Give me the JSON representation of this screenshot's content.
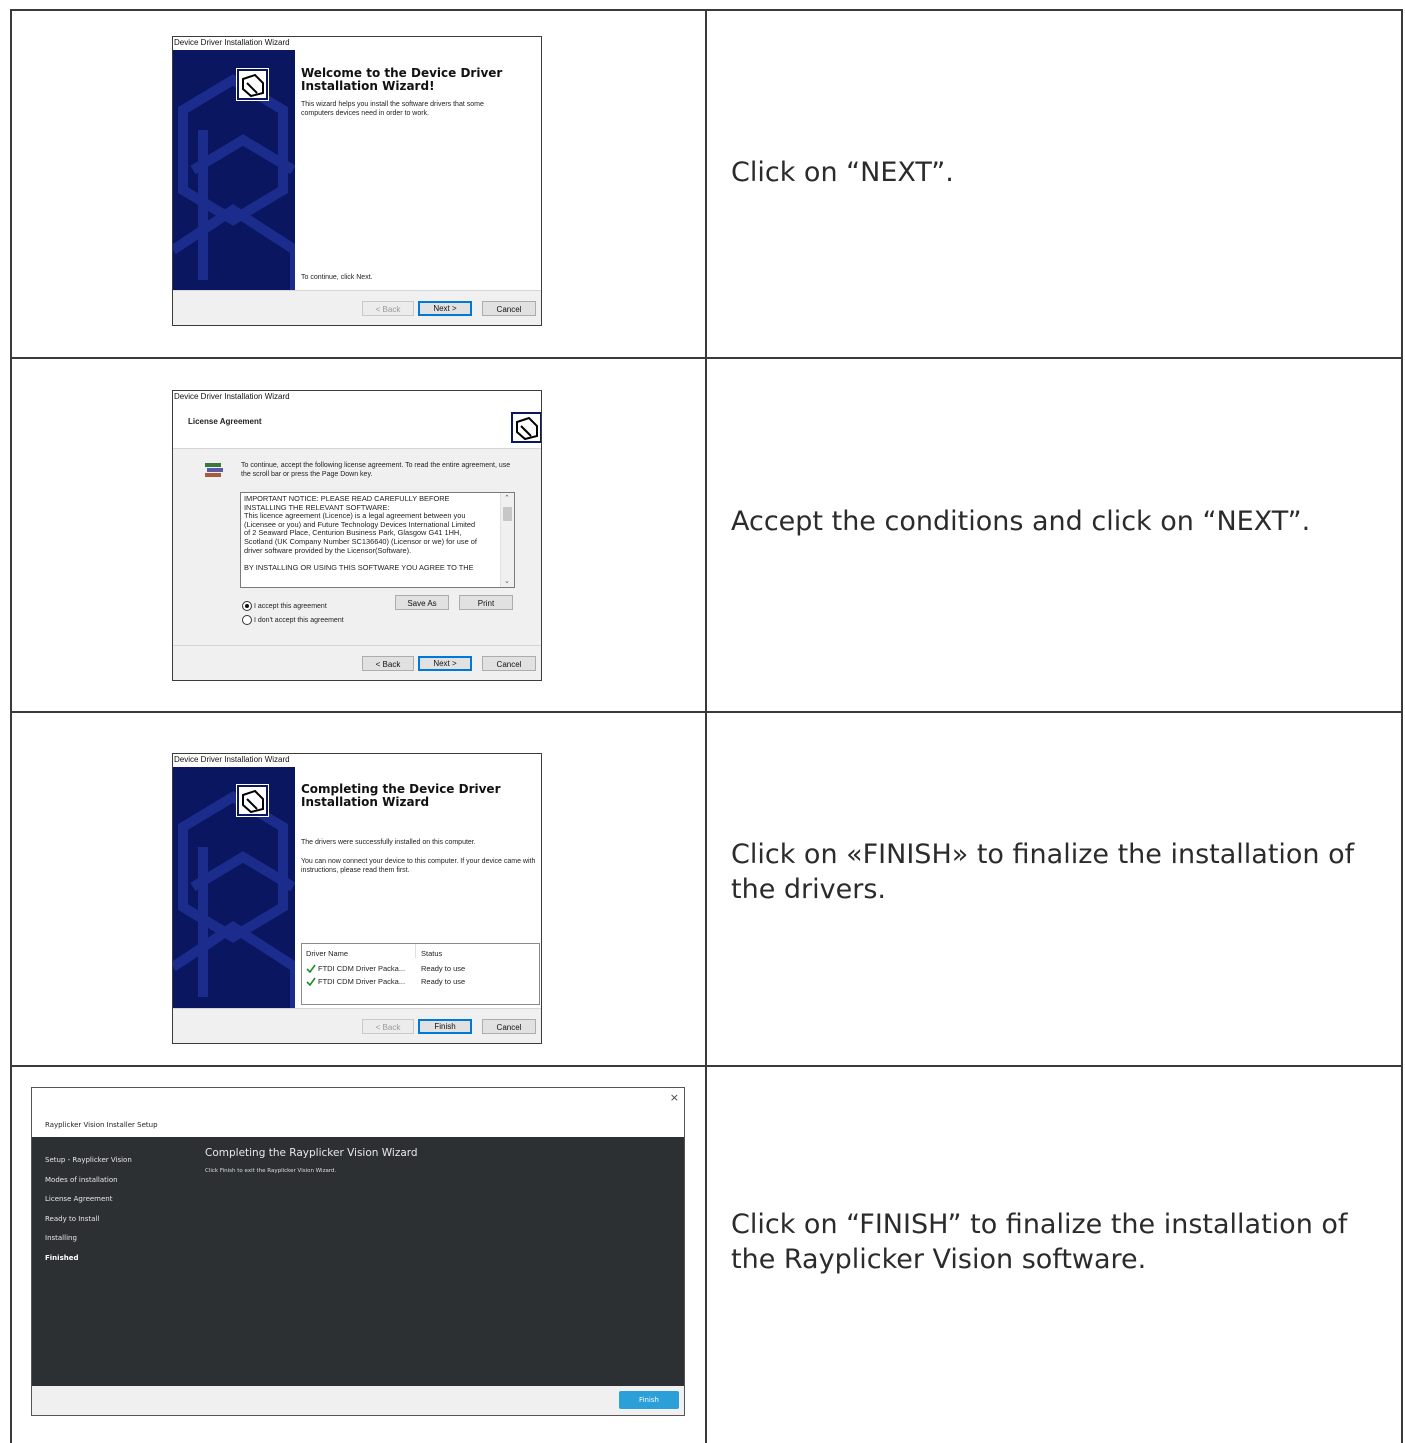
{
  "rows": [
    {
      "caption": "Click on “NEXT”.",
      "dialog": {
        "title": "Device Driver Installation Wizard",
        "heading": "Welcome to the Device Driver Installation Wizard!",
        "body": "This wizard helps you install the software drivers that some computers devices need in order to work.",
        "continue_text": "To continue, click Next.",
        "buttons": {
          "back": "< Back",
          "next": "Next >",
          "cancel": "Cancel"
        }
      }
    },
    {
      "caption": "Accept the conditions and click on “NEXT”.",
      "dialog": {
        "title": "Device Driver Installation Wizard",
        "heading": "License Agreement",
        "instructions": "To continue, accept the following license agreement. To read the entire agreement, use the scroll bar or press the Page Down key.",
        "license_lines": [
          "IMPORTANT NOTICE: PLEASE READ CAREFULLY BEFORE",
          "INSTALLING THE RELEVANT SOFTWARE:",
          "This licence agreement (Licence) is a legal agreement between you",
          "(Licensee or you) and Future Technology Devices International Limited",
          "of 2 Seaward Place, Centurion Business Park, Glasgow G41 1HH,",
          "Scotland (UK Company Number SC136640) (Licensor or we) for use of",
          "driver software provided by the Licensor(Software).",
          "",
          "BY INSTALLING OR USING THIS SOFTWARE YOU AGREE TO THE"
        ],
        "accept_label": "I accept this agreement",
        "decline_label": "I don't accept this agreement",
        "save_as": "Save As",
        "print": "Print",
        "buttons": {
          "back": "< Back",
          "next": "Next >",
          "cancel": "Cancel"
        }
      }
    },
    {
      "caption": "Click on «FINISH» to finalize the installation of the drivers.",
      "dialog": {
        "title": "Device Driver Installation Wizard",
        "heading": "Completing the Device Driver Installation Wizard",
        "body1": "The drivers were successfully installed on this computer.",
        "body2": "You can now connect your device to this computer. If your device came with instructions, please read them first.",
        "columns": {
          "name": "Driver Name",
          "status": "Status"
        },
        "drivers": [
          {
            "name": "FTDI CDM Driver Packa...",
            "status": "Ready to use"
          },
          {
            "name": "FTDI CDM Driver Packa...",
            "status": "Ready to use"
          }
        ],
        "buttons": {
          "back": "< Back",
          "finish": "Finish",
          "cancel": "Cancel"
        }
      }
    },
    {
      "caption": "Click on “FINISH” to finalize the installation of the Rayplicker Vision software.",
      "installer": {
        "title": "Rayplicker Vision Installer Setup",
        "close": "×",
        "heading": "Completing the Rayplicker Vision Wizard",
        "subtext": "Click Finish to exit the Rayplicker Vision Wizard.",
        "steps": [
          "Setup - Rayplicker Vision",
          "Modes of installation",
          "License Agreement",
          "Ready to Install",
          "Installing",
          "Finished"
        ],
        "active_step": "Finished",
        "finish_button": "Finish"
      }
    }
  ]
}
